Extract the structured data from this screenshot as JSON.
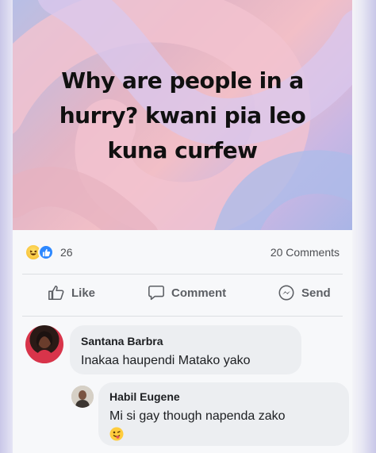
{
  "post": {
    "text": "Why are people in a hurry? kwani pia leo kuna curfew"
  },
  "stats": {
    "reaction_count": "26",
    "comments_label": "20 Comments"
  },
  "actions": {
    "like": "Like",
    "comment": "Comment",
    "send": "Send"
  },
  "comments": [
    {
      "author": "Santana Barbra",
      "text": "Inakaa haupendi Matako yako"
    },
    {
      "author": "Habil Eugene",
      "text": "Mi si gay though napenda zako",
      "emoji": "😜"
    }
  ],
  "colors": {
    "like_blue": "#2d88ff",
    "bubble_bg": "#eceef1"
  }
}
